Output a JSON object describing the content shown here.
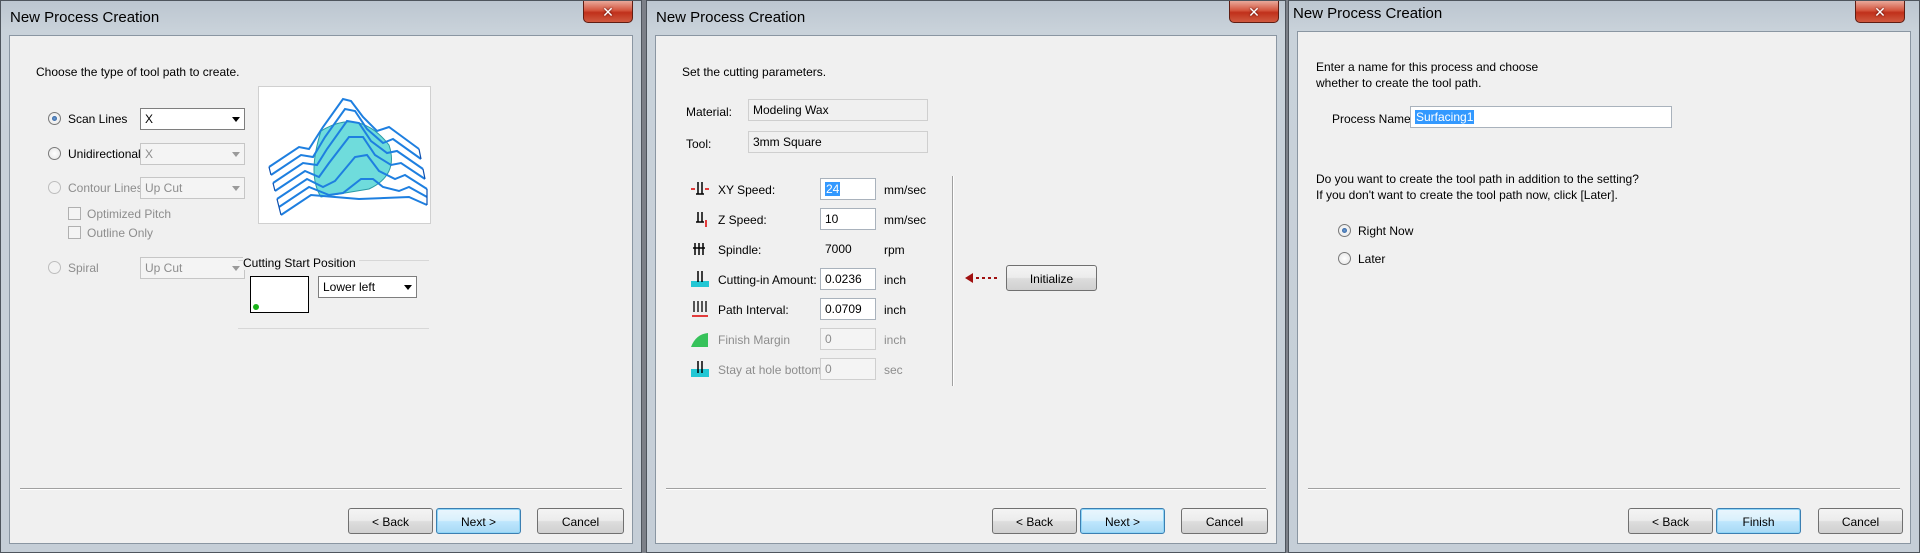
{
  "dialog1": {
    "title": "New Process Creation",
    "instruction": "Choose the type of tool path to create.",
    "options": {
      "scan_lines": {
        "label": "Scan Lines",
        "value": "X"
      },
      "unidirectional": {
        "label": "Unidirectional",
        "value": "X"
      },
      "contour_lines": {
        "label": "Contour Lines",
        "value": "Up Cut"
      },
      "optimized_pitch": "Optimized Pitch",
      "outline_only": "Outline Only",
      "spiral": {
        "label": "Spiral",
        "value": "Up Cut"
      }
    },
    "cutting_start": {
      "label": "Cutting Start Position",
      "value": "Lower left"
    },
    "buttons": {
      "back": "< Back",
      "next": "Next >",
      "cancel": "Cancel"
    }
  },
  "dialog2": {
    "title": "New Process Creation",
    "instruction": "Set the cutting parameters.",
    "material": {
      "label": "Material:",
      "value": "Modeling Wax"
    },
    "tool": {
      "label": "Tool:",
      "value": "3mm Square"
    },
    "params": [
      {
        "label": "XY Speed:",
        "value": "24",
        "unit": "mm/sec"
      },
      {
        "label": "Z Speed:",
        "value": "10",
        "unit": "mm/sec"
      },
      {
        "label": "Spindle:",
        "value": "7000",
        "unit": "rpm"
      },
      {
        "label": "Cutting-in Amount:",
        "value": "0.0236",
        "unit": "inch"
      },
      {
        "label": "Path Interval:",
        "value": "0.0709",
        "unit": "inch"
      },
      {
        "label": "Finish Margin",
        "value": "0",
        "unit": "inch"
      },
      {
        "label": "Stay at hole bottom:",
        "value": "0",
        "unit": "sec"
      }
    ],
    "initialize": "Initialize",
    "buttons": {
      "back": "< Back",
      "next": "Next >",
      "cancel": "Cancel"
    }
  },
  "dialog3": {
    "title": "New Process Creation",
    "instruction_line1": "Enter a name for this process and choose",
    "instruction_line2": "whether to create the tool path.",
    "process_name": {
      "label": "Process Name:",
      "value": "Surfacing1"
    },
    "question_line1": "Do you want to create the tool path in addition to the setting?",
    "question_line2": "If you don't want to create the tool path now, click [Later].",
    "right_now": "Right Now",
    "later": "Later",
    "buttons": {
      "back": "< Back",
      "finish": "Finish",
      "cancel": "Cancel"
    }
  },
  "colors": {
    "accent": "#3399ff",
    "toolpath": "#1e7fe0",
    "model": "#66d9d9",
    "close": "#c7422a"
  }
}
